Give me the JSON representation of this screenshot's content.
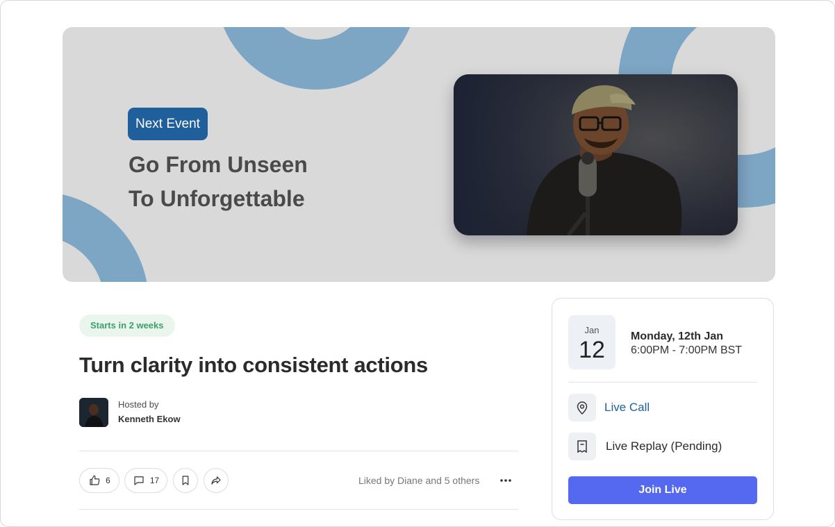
{
  "banner": {
    "badge": "Next Event",
    "title_line1": "Go From Unseen",
    "title_line2": "To Unforgettable"
  },
  "event": {
    "status": "Starts in 2 weeks",
    "title": "Turn clarity into consistent actions",
    "hosted_label": "Hosted by",
    "host_name": "Kenneth Ekow"
  },
  "actions": {
    "likes": "6",
    "comments": "17",
    "liked_by": "Liked by Diane and 5 others"
  },
  "schedule": {
    "month": "Jan",
    "day": "12",
    "date_label": "Monday, 12th Jan",
    "time_label": "6:00PM - 7:00PM BST",
    "location": "Live Call",
    "replay": "Live Replay (Pending)",
    "join_label": "Join Live"
  },
  "colors": {
    "accent_blue": "#1f5f9c",
    "join_button": "#5468f0",
    "status_green": "#3aa169",
    "decor_blue": "#7da5c4"
  }
}
